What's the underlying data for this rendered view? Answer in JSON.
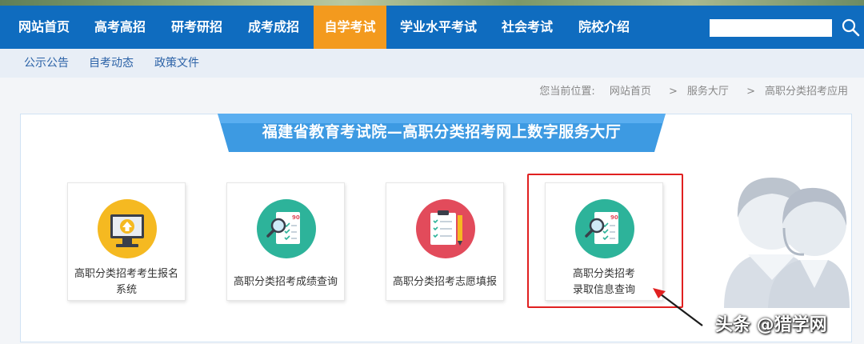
{
  "nav": {
    "items": [
      {
        "label": "网站首页"
      },
      {
        "label": "高考高招"
      },
      {
        "label": "研考研招"
      },
      {
        "label": "成考成招"
      },
      {
        "label": "自学考试",
        "active": true
      },
      {
        "label": "学业水平考试"
      },
      {
        "label": "社会考试"
      },
      {
        "label": "院校介绍"
      }
    ],
    "search_value": "",
    "active_color": "#f39a1e",
    "bar_color": "#0f6cbf"
  },
  "subnav": {
    "items": [
      {
        "label": "公示公告"
      },
      {
        "label": "自考动态"
      },
      {
        "label": "政策文件"
      }
    ]
  },
  "breadcrumb": {
    "prefix": "您当前位置:",
    "items": [
      "网站首页",
      "服务大厅",
      "高职分类招考应用"
    ],
    "separator": ">"
  },
  "banner": {
    "title": "福建省教育考试院—高职分类招考网上数字服务大厅"
  },
  "cards": [
    {
      "label": "高职分类招考考生报名系统",
      "icon": "computer-upload-icon"
    },
    {
      "label": "高职分类招考成绩查询",
      "icon": "score-check-icon"
    },
    {
      "label": "高职分类招考志愿填报",
      "icon": "application-form-icon"
    },
    {
      "label": "高职分类招考录取信息查询",
      "icon": "score-check-icon"
    }
  ],
  "watermark": "头条 @猎学网"
}
